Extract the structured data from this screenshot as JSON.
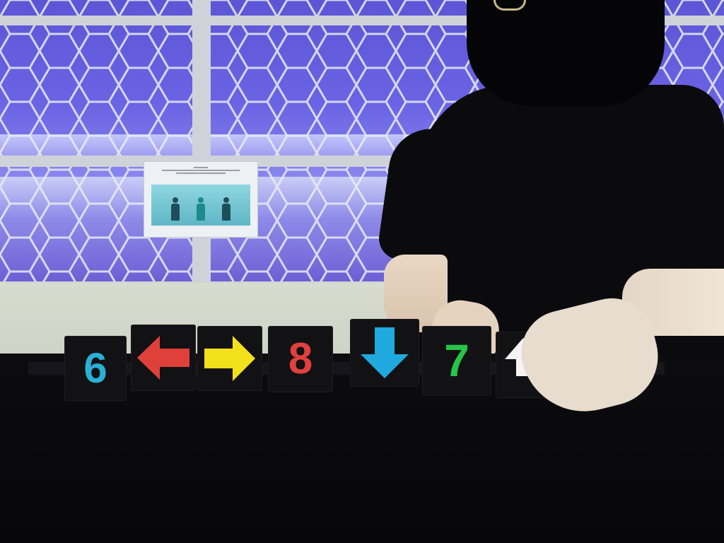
{
  "scene": {
    "description_colors": {
      "window_blue": "#6a63e4",
      "shirt": "#0b0b0e",
      "table": "#0c0c0f"
    }
  },
  "poster": {
    "figure_colors": [
      "#1f4d5a",
      "#1d8a8c",
      "#1f4d5a"
    ]
  },
  "cards": [
    {
      "kind": "number",
      "value": "6",
      "color": "#2ab0d6"
    },
    {
      "kind": "arrow",
      "direction": "left",
      "icon": "arrow-left-icon",
      "color": "#e0403a"
    },
    {
      "kind": "arrow",
      "direction": "right",
      "icon": "arrow-right-icon",
      "color": "#f2e11a"
    },
    {
      "kind": "number",
      "value": "8",
      "color": "#e2403e"
    },
    {
      "kind": "arrow",
      "direction": "down",
      "icon": "arrow-down-icon",
      "color": "#1fa9de"
    },
    {
      "kind": "number",
      "value": "7",
      "color": "#27c44a"
    },
    {
      "kind": "arrow",
      "direction": "up",
      "icon": "arrow-up-icon",
      "color": "#f4f4f4"
    }
  ]
}
